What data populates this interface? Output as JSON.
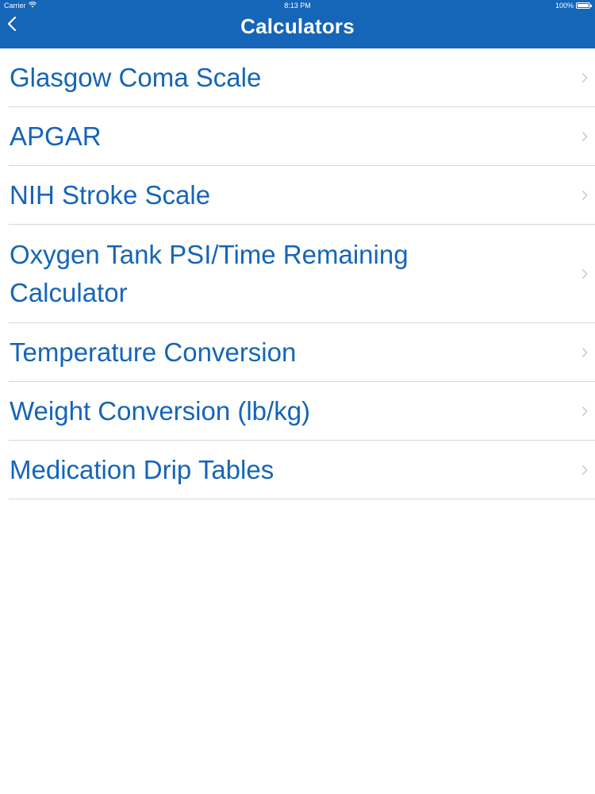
{
  "status_bar": {
    "carrier": "Carrier",
    "time": "8:13 PM",
    "battery": "100%"
  },
  "nav": {
    "title": "Calculators",
    "back_icon": "chevron-left-icon"
  },
  "list": {
    "items": [
      {
        "label": "Glasgow Coma Scale"
      },
      {
        "label": "APGAR"
      },
      {
        "label": "NIH Stroke Scale"
      },
      {
        "label": "Oxygen Tank PSI/Time Remaining Calculator"
      },
      {
        "label": "Temperature Conversion"
      },
      {
        "label": "Weight Conversion (lb/kg)"
      },
      {
        "label": "Medication Drip Tables"
      }
    ],
    "chevron_icon": "chevron-right-icon"
  },
  "colors": {
    "header": "#1565b8",
    "link": "#1565b8",
    "separator": "#d6d6d6",
    "chevron": "#c7c7cc"
  }
}
